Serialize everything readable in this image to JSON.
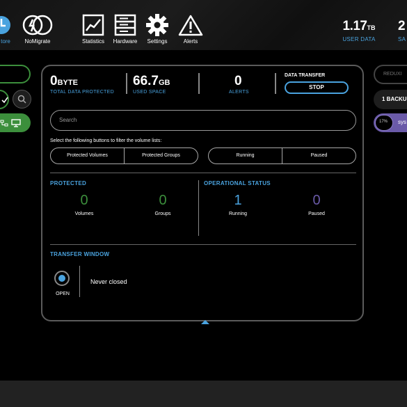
{
  "toolbar": {
    "items": [
      {
        "label": "tore",
        "icon": "restore-icon"
      },
      {
        "label": "NoMigrate",
        "icon": "no-migrate-icon"
      },
      {
        "label": "Statistics",
        "icon": "statistics-icon"
      },
      {
        "label": "Hardware",
        "icon": "hardware-icon"
      },
      {
        "label": "Settings",
        "icon": "gear-icon"
      },
      {
        "label": "Alerts",
        "icon": "alert-icon"
      }
    ],
    "stats": [
      {
        "num": "1.17",
        "unit": "TB",
        "caption": "USER DATA"
      },
      {
        "num": "2",
        "unit": "",
        "caption": "SA"
      }
    ]
  },
  "summary": {
    "protected": {
      "value": "0",
      "unit": "BYTE",
      "caption": "TOTAL DATA PROTECTED"
    },
    "used": {
      "value": "66.7",
      "unit": "GB",
      "caption": "USED SPACE"
    },
    "alerts": {
      "value": "0",
      "caption": "ALERTS"
    },
    "transfer": {
      "caption": "DATA TRANSFER",
      "button": "STOP"
    }
  },
  "search": {
    "placeholder": "Search"
  },
  "filter": {
    "hint": "Select the following buttons to filter the volume lists:",
    "group1": [
      "Protected Volumes",
      "Protected Groups"
    ],
    "group2": [
      "Running",
      "Paused"
    ]
  },
  "protected_section": {
    "title": "PROTECTED",
    "metrics": [
      {
        "value": "0",
        "label": "Volumes"
      },
      {
        "value": "0",
        "label": "Groups"
      }
    ]
  },
  "status_section": {
    "title": "OPERATIONAL STATUS",
    "metrics": [
      {
        "value": "1",
        "label": "Running"
      },
      {
        "value": "0",
        "label": "Paused"
      }
    ]
  },
  "transfer_window": {
    "title": "TRANSFER WINDOW",
    "state": "OPEN",
    "text": "Never closed"
  },
  "right_panel": {
    "redux_label": "REDUXI",
    "backup_label": "1 BACKU",
    "progress_label": "17%",
    "progress_value": 17,
    "system_label": "sys"
  },
  "colors": {
    "accent": "#4aa3df",
    "green": "#3c8f3c",
    "purple": "#6a5aa8"
  }
}
